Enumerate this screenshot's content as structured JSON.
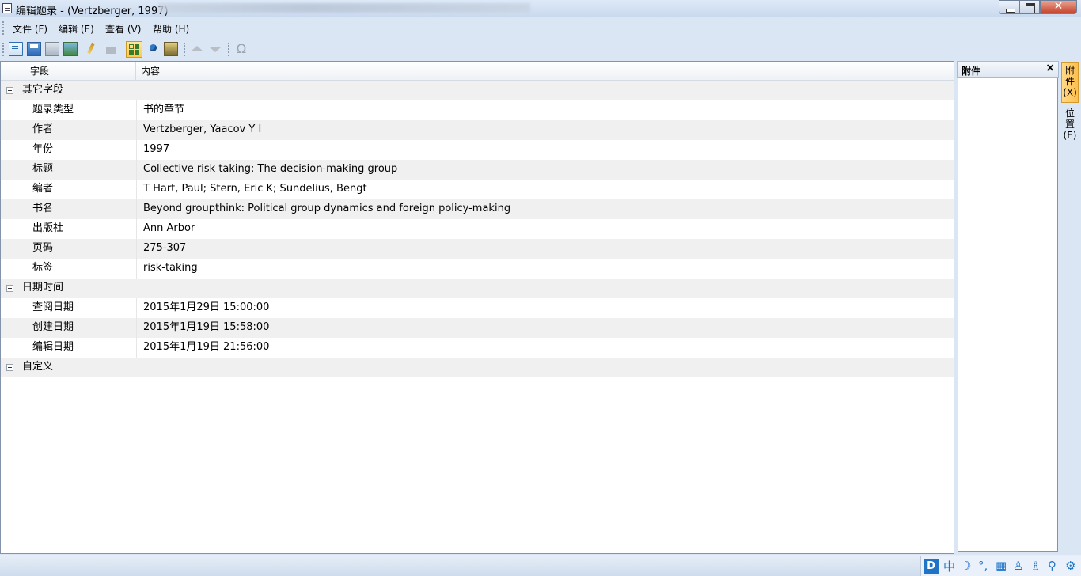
{
  "window": {
    "title": "编辑题录 - (Vertzberger, 1997)",
    "close_glyph": "✕"
  },
  "menu": [
    {
      "label": "文件 (F)"
    },
    {
      "label": "编辑 (E)"
    },
    {
      "label": "查看 (V)"
    },
    {
      "label": "帮助 (H)"
    }
  ],
  "toolbar": {
    "omega_glyph": "Ω"
  },
  "grid": {
    "headers": {
      "field": "字段",
      "content": "内容"
    },
    "groups": {
      "other": "其它字段",
      "datetime": "日期时间",
      "custom": "自定义"
    },
    "other_fields": [
      {
        "field": "题录类型",
        "value": "书的章节"
      },
      {
        "field": "作者",
        "value": "Vertzberger, Yaacov Y I"
      },
      {
        "field": "年份",
        "value": "1997"
      },
      {
        "field": "标题",
        "value": "Collective risk taking: The decision-making group"
      },
      {
        "field": "编者",
        "value": "T Hart, Paul; Stern, Eric K; Sundelius, Bengt"
      },
      {
        "field": "书名",
        "value": "Beyond groupthink: Political group dynamics and foreign policy-making"
      },
      {
        "field": "出版社",
        "value": "Ann Arbor"
      },
      {
        "field": "页码",
        "value": "275-307"
      },
      {
        "field": "标签",
        "value": "risk-taking"
      }
    ],
    "datetime_fields": [
      {
        "field": "查阅日期",
        "value": "2015年1月29日 15:00:00"
      },
      {
        "field": "创建日期",
        "value": "2015年1月19日 15:58:00"
      },
      {
        "field": "编辑日期",
        "value": "2015年1月19日 21:56:00"
      }
    ]
  },
  "side_panel": {
    "title": "附件",
    "close_glyph": "×"
  },
  "vertical_tabs": {
    "attachments": "附件(X)",
    "location": "位置(E)"
  },
  "tray": {
    "logo": "D",
    "ime": "中"
  },
  "colors": {
    "accent": "#1f74c8",
    "active_tab": "#ffc94a",
    "alt_row": "#f0f0f0"
  }
}
